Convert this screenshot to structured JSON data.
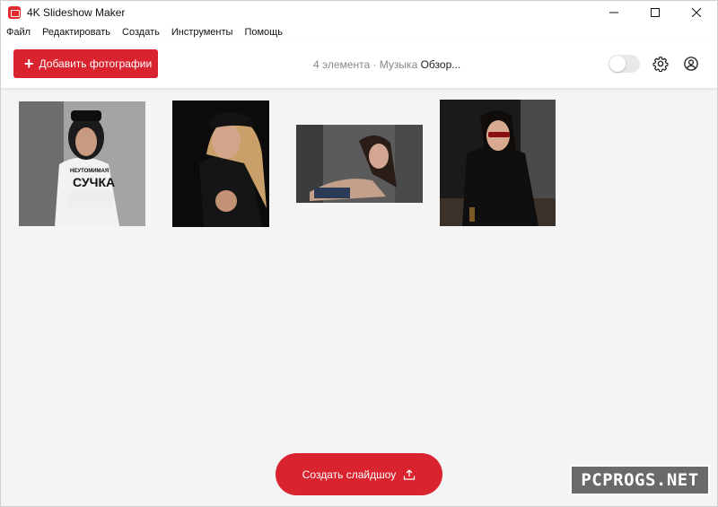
{
  "window": {
    "title": "4K Slideshow Maker"
  },
  "menu": {
    "items": [
      "Файл",
      "Редактировать",
      "Создать",
      "Инструменты",
      "Помощь"
    ]
  },
  "toolbar": {
    "add_label": "Добавить фотографии",
    "status_count": "4 элемента · Музыка",
    "browse_label": "Обзор...",
    "toggle_on": false
  },
  "photos": [
    {
      "caption": "СУЧКА",
      "caption_small": "НЕУТОМИМАЯ"
    },
    {},
    {},
    {}
  ],
  "footer": {
    "create_label": "Создать слайдшоу"
  },
  "watermark": {
    "text": "PCPROGS.NET"
  },
  "colors": {
    "accent": "#d9232f",
    "background": "#f4f4f4"
  }
}
